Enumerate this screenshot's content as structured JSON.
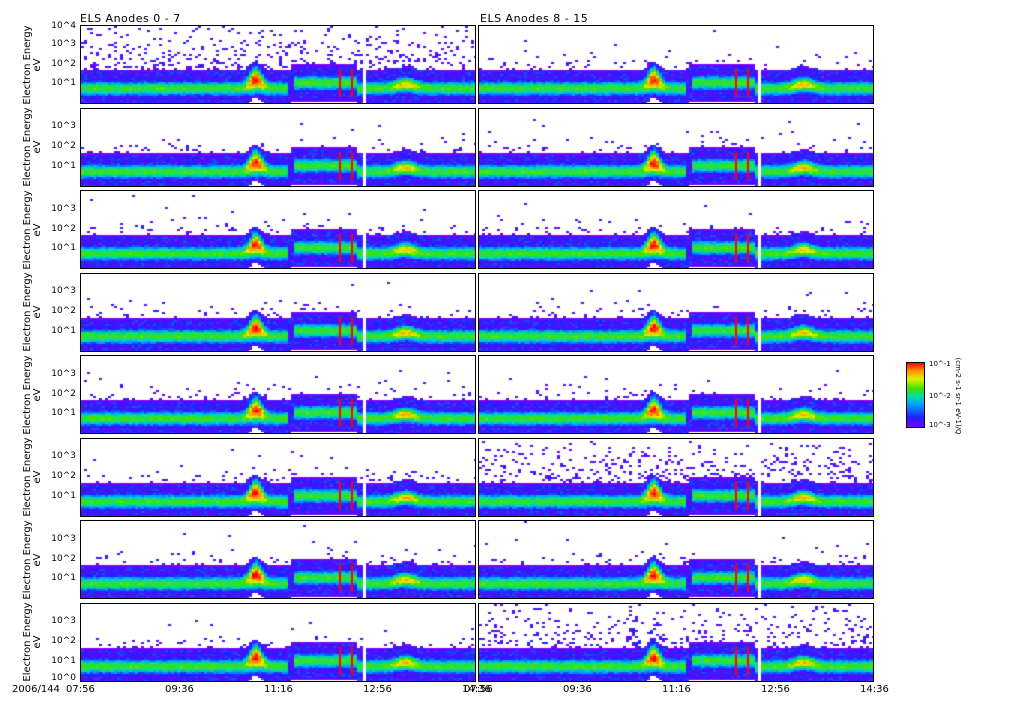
{
  "titles": {
    "left": "ELS Anodes 0 - 7",
    "right": "ELS Anodes 8 - 15"
  },
  "ylabel": {
    "line1": "Electron Energy",
    "line2": "eV"
  },
  "colors": {
    "accent_red": "#ff0000",
    "low": "#7a00ff"
  },
  "chart_data": {
    "type": "heatmap",
    "title": "ELS Anodes 0 - 7 / ELS Anodes 8 - 15",
    "xlabel": "2006/144",
    "ylabel": "Electron Energy eV",
    "x_ticks": [
      "07:56",
      "09:36",
      "11:16",
      "12:56",
      "14:36"
    ],
    "x_date": "2006/144",
    "ylim_log10": [
      0,
      4
    ],
    "y_ticks_top_panel": [
      "10^4",
      "10^3",
      "10^2",
      "10^1"
    ],
    "y_ticks": [
      "10^3",
      "10^2",
      "10^1"
    ],
    "y_ticks_bottom_panel": [
      "10^3",
      "10^2",
      "10^1",
      "10^0"
    ],
    "rows": 8,
    "columns": [
      "Anodes 0 - 7",
      "Anodes 8 - 15"
    ],
    "features": {
      "core_band_log10_eV": 0.8,
      "burst_time": "11:00",
      "data_gap_time": "11:28",
      "spikes_times": [
        "12:18",
        "12:30"
      ],
      "white_gap_time": "12:40",
      "enhancement_time": "13:30"
    },
    "colorbar": {
      "ticks": [
        "10^-1",
        "10^-2",
        "10^-3"
      ],
      "label": "(cm-2 s-1 sr-1 eV-1)/Q"
    }
  }
}
